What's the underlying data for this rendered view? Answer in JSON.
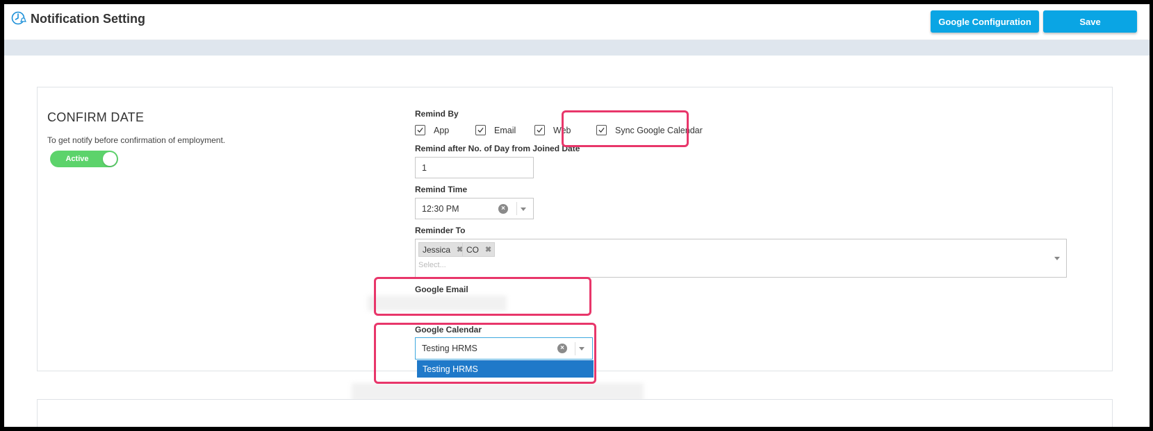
{
  "header": {
    "title": "Notification Setting",
    "google_configuration_label": "Google Configuration",
    "save_label": "Save"
  },
  "section": {
    "title": "CONFIRM DATE",
    "description": "To get notify before confirmation of employment.",
    "status_toggle": "Active",
    "status_on": true
  },
  "remind_by": {
    "label": "Remind By",
    "options": [
      {
        "label": "App",
        "checked": true
      },
      {
        "label": "Email",
        "checked": true
      },
      {
        "label": "Web",
        "checked": true
      },
      {
        "label": "Sync Google Calendar",
        "checked": true
      }
    ]
  },
  "remind_after": {
    "label": "Remind after No. of Day from Joined Date",
    "value": "1"
  },
  "remind_time": {
    "label": "Remind Time",
    "value": "12:30 PM"
  },
  "reminder_to": {
    "label": "Reminder To",
    "tags": [
      "Jessica",
      "CO"
    ],
    "placeholder": "Select..."
  },
  "google_email": {
    "label": "Google Email"
  },
  "google_calendar": {
    "label": "Google Calendar",
    "value": "Testing HRMS",
    "options": [
      "Testing HRMS"
    ]
  },
  "colors": {
    "accent": "#0aa5e4",
    "toggle_active": "#5cd36b",
    "highlight": "#e8366a",
    "dropdown_selected": "#1f79c9"
  }
}
